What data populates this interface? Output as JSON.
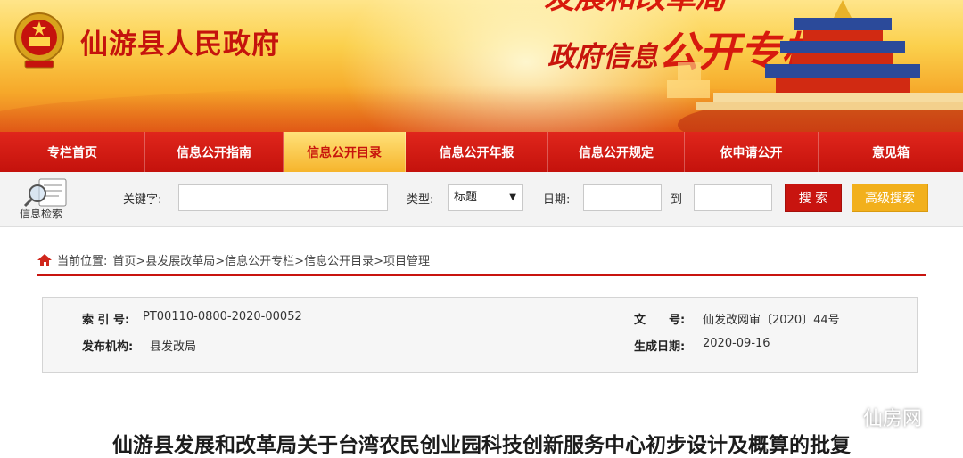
{
  "banner": {
    "site_title": "仙游县人民政府",
    "dept_partial": "发展和改革局",
    "column_title_a": "政府信息",
    "column_title_b": "公开专栏"
  },
  "nav": {
    "items": [
      {
        "label": "专栏首页",
        "active": false
      },
      {
        "label": "信息公开指南",
        "active": false
      },
      {
        "label": "信息公开目录",
        "active": true
      },
      {
        "label": "信息公开年报",
        "active": false
      },
      {
        "label": "信息公开规定",
        "active": false
      },
      {
        "label": "依申请公开",
        "active": false
      },
      {
        "label": "意见箱",
        "active": false
      }
    ]
  },
  "search": {
    "icon_label": "信息检索",
    "keyword_label": "关键字:",
    "keyword_value": "",
    "type_label": "类型:",
    "type_selected": "标题",
    "date_label": "日期:",
    "date_from": "",
    "to_label": "到",
    "date_to": "",
    "search_button": "搜 索",
    "advanced_button": "高级搜索"
  },
  "breadcrumb": {
    "prefix": "当前位置:",
    "path": "首页>县发展改革局>信息公开专栏>信息公开目录>项目管理"
  },
  "info": {
    "index_label": "索 引 号:",
    "index_value": "PT00110-0800-2020-00052",
    "docno_label": "文　　号:",
    "docno_value": "仙发改网审〔2020〕44号",
    "publisher_label": "发布机构:",
    "publisher_value": "县发改局",
    "date_label": "生成日期:",
    "date_value": "2020-09-16"
  },
  "document": {
    "title": "仙游县发展和改革局关于台湾农民创业园科技创新服务中心初步设计及概算的批复"
  },
  "watermark": {
    "text": "仙房网"
  },
  "colors": {
    "brand_red": "#c8140f",
    "accent_gold": "#f2b01c"
  }
}
